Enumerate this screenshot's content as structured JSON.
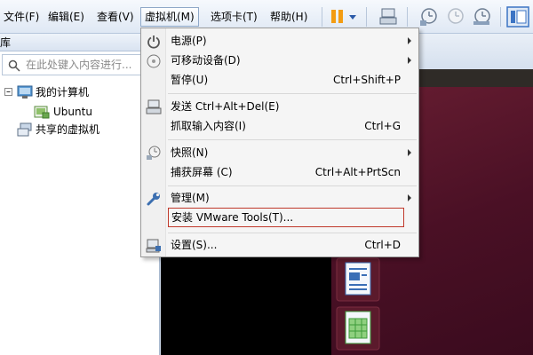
{
  "menubar": {
    "items": [
      {
        "label": "文件(F)"
      },
      {
        "label": "编辑(E)"
      },
      {
        "label": "查看(V)"
      },
      {
        "label": "虚拟机(M)"
      },
      {
        "label": "选项卡(T)"
      },
      {
        "label": "帮助(H)"
      }
    ],
    "toolbar_icons": [
      "pause-icon",
      "dropdown-arrow-icon",
      "send-keys-icon",
      "snapshot-icon",
      "revert-snapshot-icon",
      "snapshot-manager-icon",
      "view-toggle-icon"
    ]
  },
  "library": {
    "title": "库",
    "search_placeholder": "在此处键入内容进行...",
    "tree": [
      {
        "label": "我的计算机",
        "icon": "computer-icon"
      },
      {
        "label": "Ubuntu",
        "icon": "vm-icon"
      },
      {
        "label": "共享的虚拟机",
        "icon": "shared-vm-icon"
      }
    ]
  },
  "dropdown": {
    "items": [
      {
        "label": "电源(P)",
        "shortcut": "",
        "icon": "power-icon",
        "submenu": true
      },
      {
        "label": "可移动设备(D)",
        "shortcut": "",
        "icon": "removable-device-icon",
        "submenu": true
      },
      {
        "label": "暂停(U)",
        "shortcut": "Ctrl+Shift+P",
        "icon": "",
        "submenu": false
      },
      {
        "label": "发送 Ctrl+Alt+Del(E)",
        "shortcut": "",
        "icon": "send-keys-icon",
        "submenu": false
      },
      {
        "label": "抓取输入内容(I)",
        "shortcut": "Ctrl+G",
        "icon": "",
        "submenu": false
      },
      {
        "label": "快照(N)",
        "shortcut": "",
        "icon": "snapshot-icon",
        "submenu": true
      },
      {
        "label": "捕获屏幕 (C)",
        "shortcut": "Ctrl+Alt+PrtScn",
        "icon": "",
        "submenu": false
      },
      {
        "label": "管理(M)",
        "shortcut": "",
        "icon": "wrench-icon",
        "submenu": true
      },
      {
        "label": "安装 VMware Tools(T)...",
        "shortcut": "",
        "icon": "",
        "submenu": false,
        "highlighted": true
      },
      {
        "label": "设置(S)...",
        "shortcut": "Ctrl+D",
        "icon": "settings-icon",
        "submenu": false
      }
    ]
  },
  "colors": {
    "pause_accent": "#f39c12",
    "highlight_border": "#c0392b",
    "vm_desktop": "#4a1025"
  }
}
